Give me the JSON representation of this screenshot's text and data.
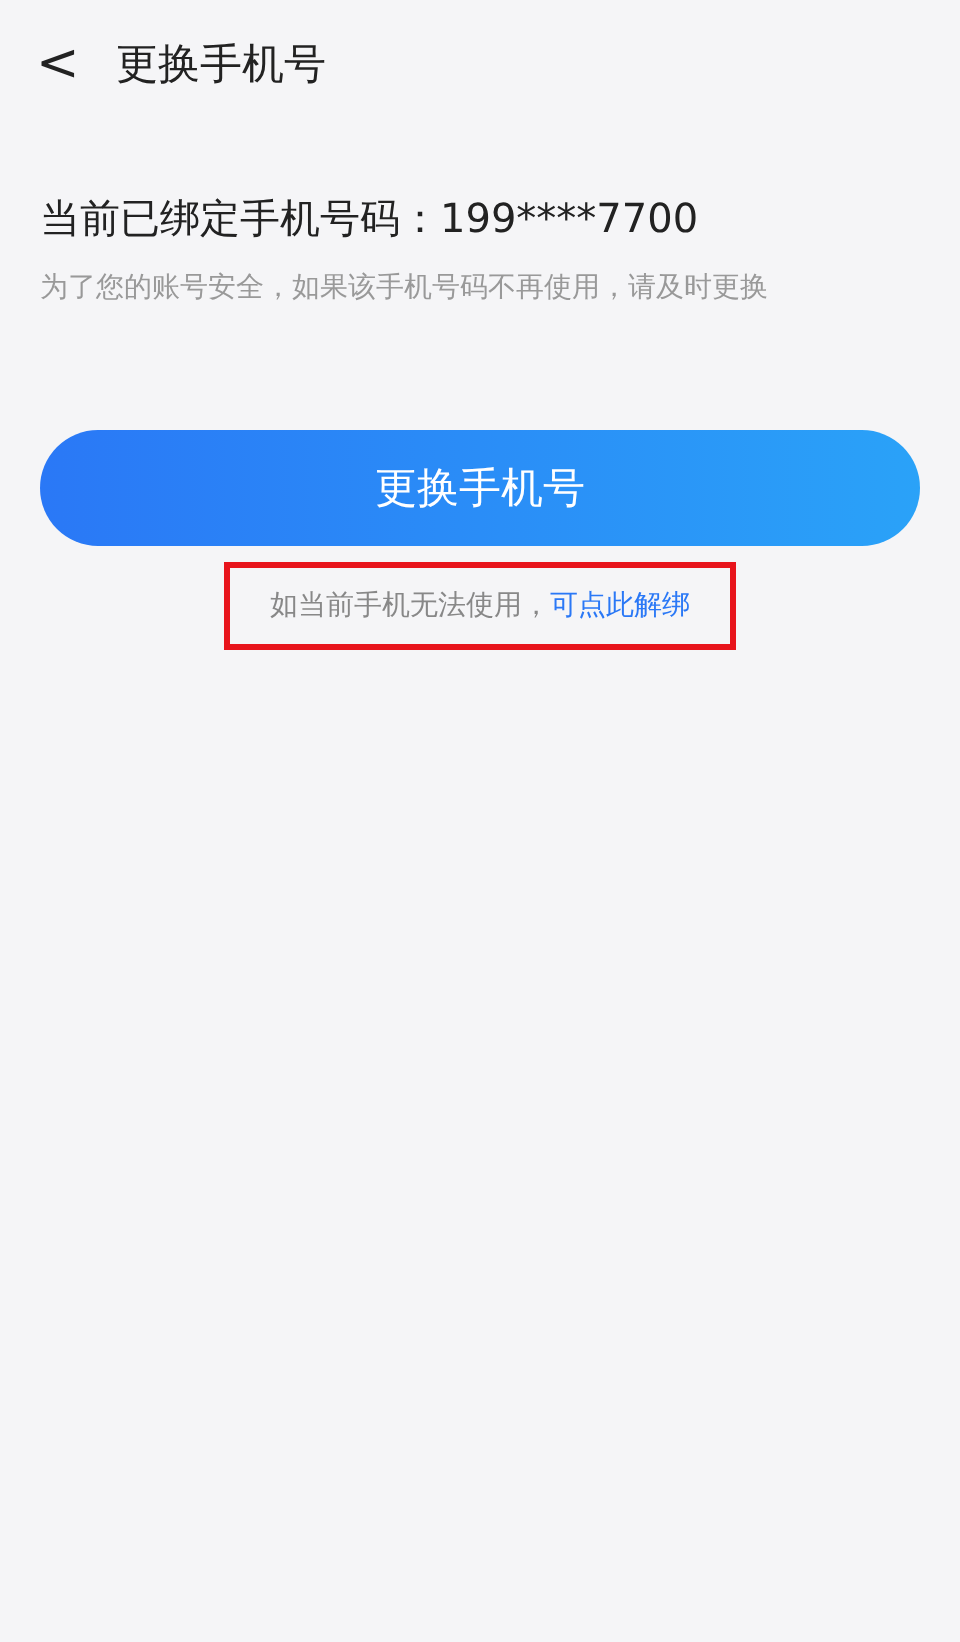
{
  "header": {
    "back": "<",
    "title": "更换手机号"
  },
  "bound": {
    "label": "当前已绑定手机号码：199****7700",
    "hint": "为了您的账号安全，如果该手机号码不再使用，请及时更换"
  },
  "button": "更换手机号",
  "note": {
    "text": "如当前手机无法使用，",
    "link": "可点此解绑",
    "highlighted": true
  }
}
